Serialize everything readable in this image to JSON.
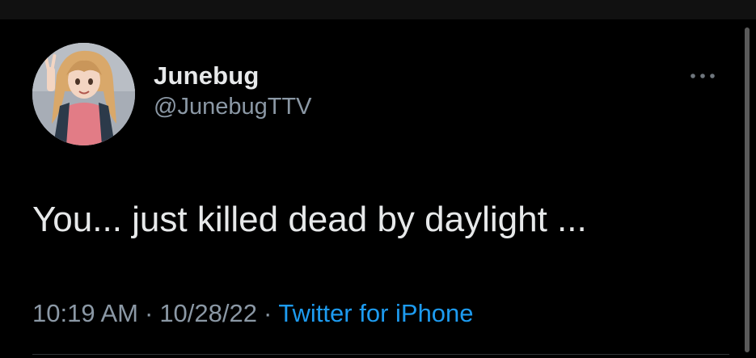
{
  "tweet": {
    "author": {
      "display_name": "Junebug",
      "handle": "@JunebugTTV",
      "avatar_icon": "anime-girl-avatar"
    },
    "text": "You... just killed dead by daylight ...",
    "meta": {
      "time": "10:19 AM",
      "separator": "·",
      "date": "10/28/22",
      "source": "Twitter for iPhone"
    },
    "more_icon": "more-horizontal-icon"
  },
  "colors": {
    "background": "#000000",
    "primary_text": "#e7e9ea",
    "secondary_text": "#8b98a5",
    "link": "#1d9bf0"
  }
}
